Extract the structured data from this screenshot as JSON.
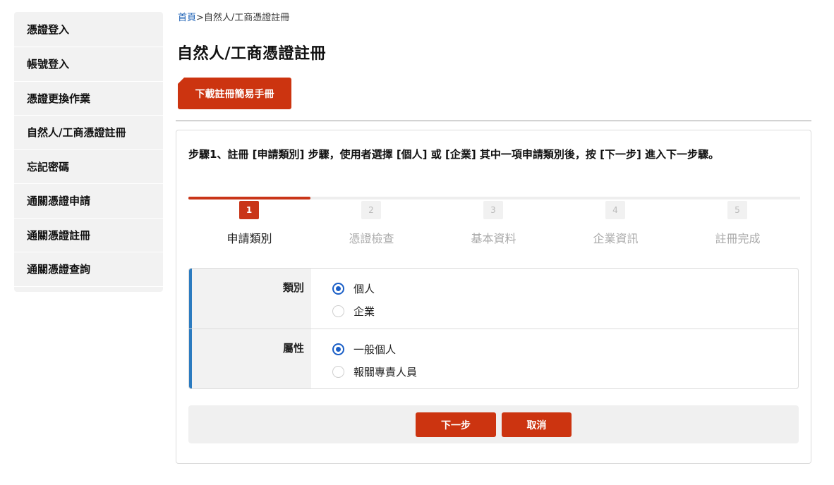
{
  "sidebar": {
    "items": [
      {
        "label": "憑證登入"
      },
      {
        "label": "帳號登入"
      },
      {
        "label": "憑證更換作業"
      },
      {
        "label": "自然人/工商憑證註冊"
      },
      {
        "label": "忘記密碼"
      },
      {
        "label": "通關憑證申請"
      },
      {
        "label": "通關憑證註冊"
      },
      {
        "label": "通關憑證查詢"
      }
    ]
  },
  "breadcrumb": {
    "home": "首頁",
    "current": ">自然人/工商憑證註冊"
  },
  "page_title": "自然人/工商憑證註冊",
  "download_button": "下載註冊簡易手冊",
  "step_description": "步驟1、註冊 [申請類別] 步驟，使用者選擇 [個人] 或 [企業] 其中一項申請類別後，按 [下一步] 進入下一步驟。",
  "stepper": {
    "progress": 0.2,
    "active_step": 1,
    "steps": [
      {
        "num": "1",
        "label": "申請類別"
      },
      {
        "num": "2",
        "label": "憑證檢查"
      },
      {
        "num": "3",
        "label": "基本資料"
      },
      {
        "num": "4",
        "label": "企業資訊"
      },
      {
        "num": "5",
        "label": "註冊完成"
      }
    ]
  },
  "form": {
    "category": {
      "label": "類別",
      "options": [
        "個人",
        "企業"
      ],
      "selected": "個人"
    },
    "attribute": {
      "label": "屬性",
      "options": [
        "一般個人",
        "報關專責人員"
      ],
      "selected": "一般個人"
    }
  },
  "buttons": {
    "next": "下一步",
    "cancel": "取消"
  },
  "colors": {
    "accent_red": "#cc3410",
    "radio_blue": "#1b5fc7",
    "form_accent_blue": "#2b7bc0",
    "link_blue": "#1a5fb4"
  }
}
